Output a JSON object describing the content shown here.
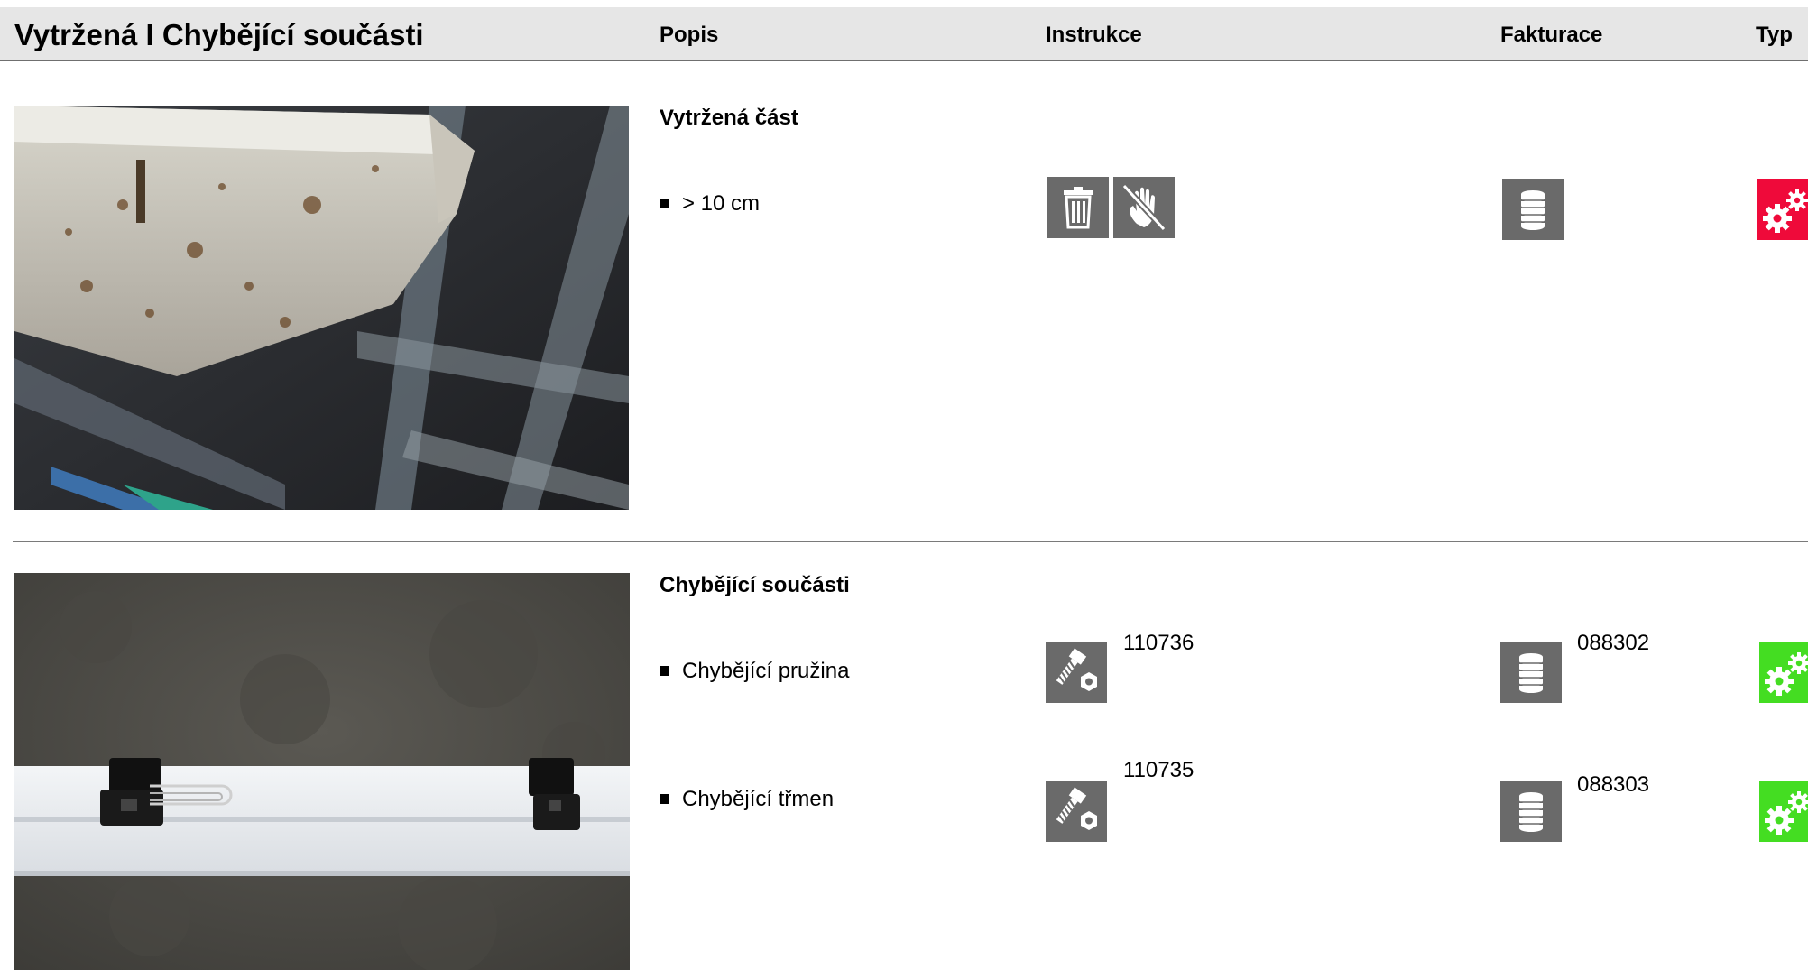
{
  "header": {
    "title": "Vytržená I Chybějící součásti",
    "col_popis": "Popis",
    "col_instrukce": "Instrukce",
    "col_fakturace": "Fakturace",
    "col_typ": "Typ"
  },
  "colors": {
    "header_bg": "#e6e6e6",
    "icon_gray": "#6a6a6a",
    "type_red": "#ef0a3a",
    "type_green": "#44dd22"
  },
  "sections": [
    {
      "title": "Vytržená část",
      "items": [
        {
          "label": "> 10 cm",
          "instruction_icons": [
            "trash-icon",
            "no-touch-hand-icon"
          ],
          "instruction_code": "",
          "billing_icon": "coin-stack-icon",
          "billing_code": "",
          "type_icon": "gears-icon",
          "type_color": "red"
        }
      ]
    },
    {
      "title": "Chybějící součásti",
      "items": [
        {
          "label": "Chybějící pružina",
          "instruction_icons": [
            "bolt-nut-icon"
          ],
          "instruction_code": "110736",
          "billing_icon": "coin-stack-icon",
          "billing_code": "088302",
          "type_icon": "gears-icon",
          "type_color": "green"
        },
        {
          "label": "Chybějící třmen",
          "instruction_icons": [
            "bolt-nut-icon"
          ],
          "instruction_code": "110735",
          "billing_icon": "coin-stack-icon",
          "billing_code": "088303",
          "type_icon": "gears-icon",
          "type_color": "green"
        }
      ]
    }
  ]
}
